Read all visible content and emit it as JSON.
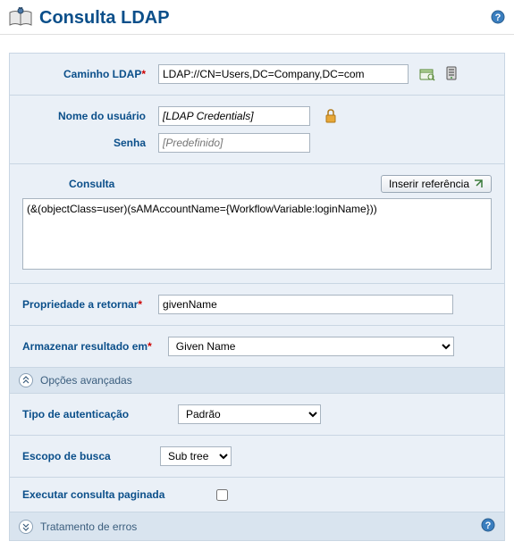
{
  "header": {
    "title": "Consulta LDAP"
  },
  "ldapPath": {
    "label": "Caminho LDAP",
    "value": "LDAP://CN=Users,DC=Company,DC=com"
  },
  "username": {
    "label": "Nome do usuário",
    "value": "[LDAP Credentials]"
  },
  "password": {
    "label": "Senha",
    "placeholder": "[Predefinido]"
  },
  "query": {
    "label": "Consulta",
    "insertRefBtn": "Inserir referência",
    "value": "(&(objectClass=user)(sAMAccountName={WorkflowVariable:loginName}))"
  },
  "propertyReturn": {
    "label": "Propriedade a retornar",
    "value": "givenName"
  },
  "storeResult": {
    "label": "Armazenar resultado em",
    "value": "Given Name"
  },
  "advanced": {
    "header": "Opções avançadas",
    "authType": {
      "label": "Tipo de autenticação",
      "value": "Padrão"
    },
    "searchScope": {
      "label": "Escopo de busca",
      "value": "Sub tree"
    },
    "pagedQuery": {
      "label": "Executar consulta paginada",
      "checked": false
    }
  },
  "errorHandling": {
    "header": "Tratamento de erros"
  }
}
